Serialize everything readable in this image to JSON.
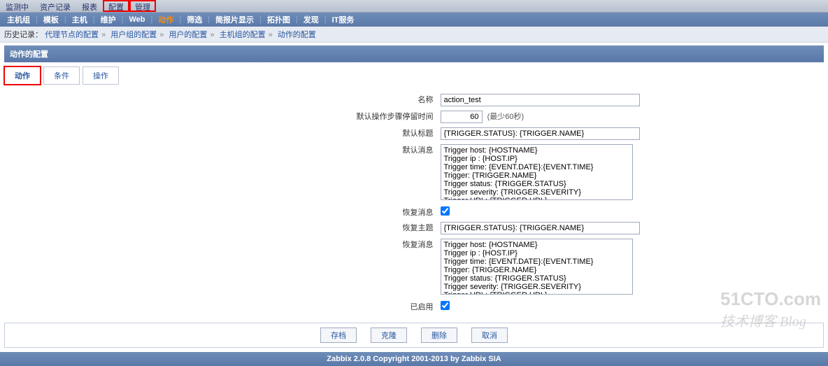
{
  "topnav": {
    "items": [
      {
        "label": "监测中"
      },
      {
        "label": "资产记录"
      },
      {
        "label": "报表"
      },
      {
        "label": "配置",
        "highlight": true
      },
      {
        "label": "管理",
        "highlight": true
      }
    ]
  },
  "subnav": {
    "items": [
      {
        "label": "主机组"
      },
      {
        "label": "模板"
      },
      {
        "label": "主机"
      },
      {
        "label": "维护"
      },
      {
        "label": "Web"
      },
      {
        "label": "动作",
        "active": true
      },
      {
        "label": "筛选"
      },
      {
        "label": "简报片显示"
      },
      {
        "label": "拓扑图"
      },
      {
        "label": "发现"
      },
      {
        "label": "IT服务"
      }
    ]
  },
  "breadcrumb": {
    "label": "历史记录：",
    "items": [
      "代理节点的配置",
      "用户组的配置",
      "用户的配置",
      "主机组的配置",
      "动作的配置"
    ]
  },
  "header": {
    "title": "动作的配置"
  },
  "tabs": [
    {
      "label": "动作",
      "active": true,
      "highlight": true
    },
    {
      "label": "条件"
    },
    {
      "label": "操作"
    }
  ],
  "form": {
    "name_label": "名称",
    "name_value": "action_test",
    "step_label": "默认操作步骤停留时间",
    "step_value": "60",
    "step_note": "(最少60秒)",
    "subject_label": "默认标题",
    "subject_value": "{TRIGGER.STATUS}: {TRIGGER.NAME}",
    "message_label": "默认消息",
    "message_value": "Trigger host: {HOSTNAME}\nTrigger ip : {HOST.IP}\nTrigger time: {EVENT.DATE}:{EVENT.TIME}\nTrigger: {TRIGGER.NAME}\nTrigger status: {TRIGGER.STATUS}\nTrigger severity: {TRIGGER.SEVERITY}\nTrigger URL: {TRIGGER.URL}",
    "recovery_label": "恢复消息",
    "recovery_checked": true,
    "r_subject_label": "恢复主题",
    "r_subject_value": "{TRIGGER.STATUS}: {TRIGGER.NAME}",
    "r_message_label": "恢复消息",
    "r_message_value": "Trigger host: {HOSTNAME}\nTrigger ip : {HOST.IP}\nTrigger time: {EVENT.DATE}:{EVENT.TIME}\nTrigger: {TRIGGER.NAME}\nTrigger status: {TRIGGER.STATUS}\nTrigger severity: {TRIGGER.SEVERITY}\nTrigger URL: {TRIGGER.URL}",
    "enabled_label": "已启用",
    "enabled_checked": true
  },
  "buttons": {
    "save": "存档",
    "clone": "克隆",
    "delete": "删除",
    "cancel": "取消"
  },
  "footer": {
    "text": "Zabbix 2.0.8 Copyright 2001-2013 by Zabbix SIA"
  },
  "watermark": {
    "line1": "51CTO.com",
    "line2": "技术博客",
    "suffix": "Blog"
  }
}
